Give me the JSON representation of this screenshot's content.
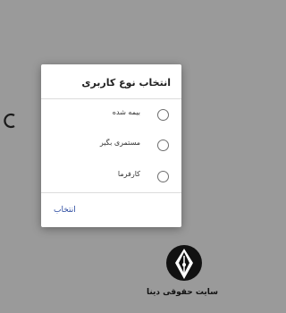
{
  "dialog": {
    "title": "انتخاب نوع کاربری",
    "options": [
      {
        "label": "بیمه شده",
        "selected": false
      },
      {
        "label": "مستمری بگیر",
        "selected": false
      },
      {
        "label": "کارفرما",
        "selected": false
      }
    ],
    "action_label": "انتخاب"
  },
  "watermark": {
    "text": "سایت حقوقی دینا",
    "logo_icon": "pen-nib-logo"
  },
  "background": {
    "partial_glyph_icon": "partial-c-glyph"
  },
  "colors": {
    "overlay": "#9a9a9a",
    "dialog_bg": "#ffffff",
    "accent": "#2a4aa0"
  }
}
